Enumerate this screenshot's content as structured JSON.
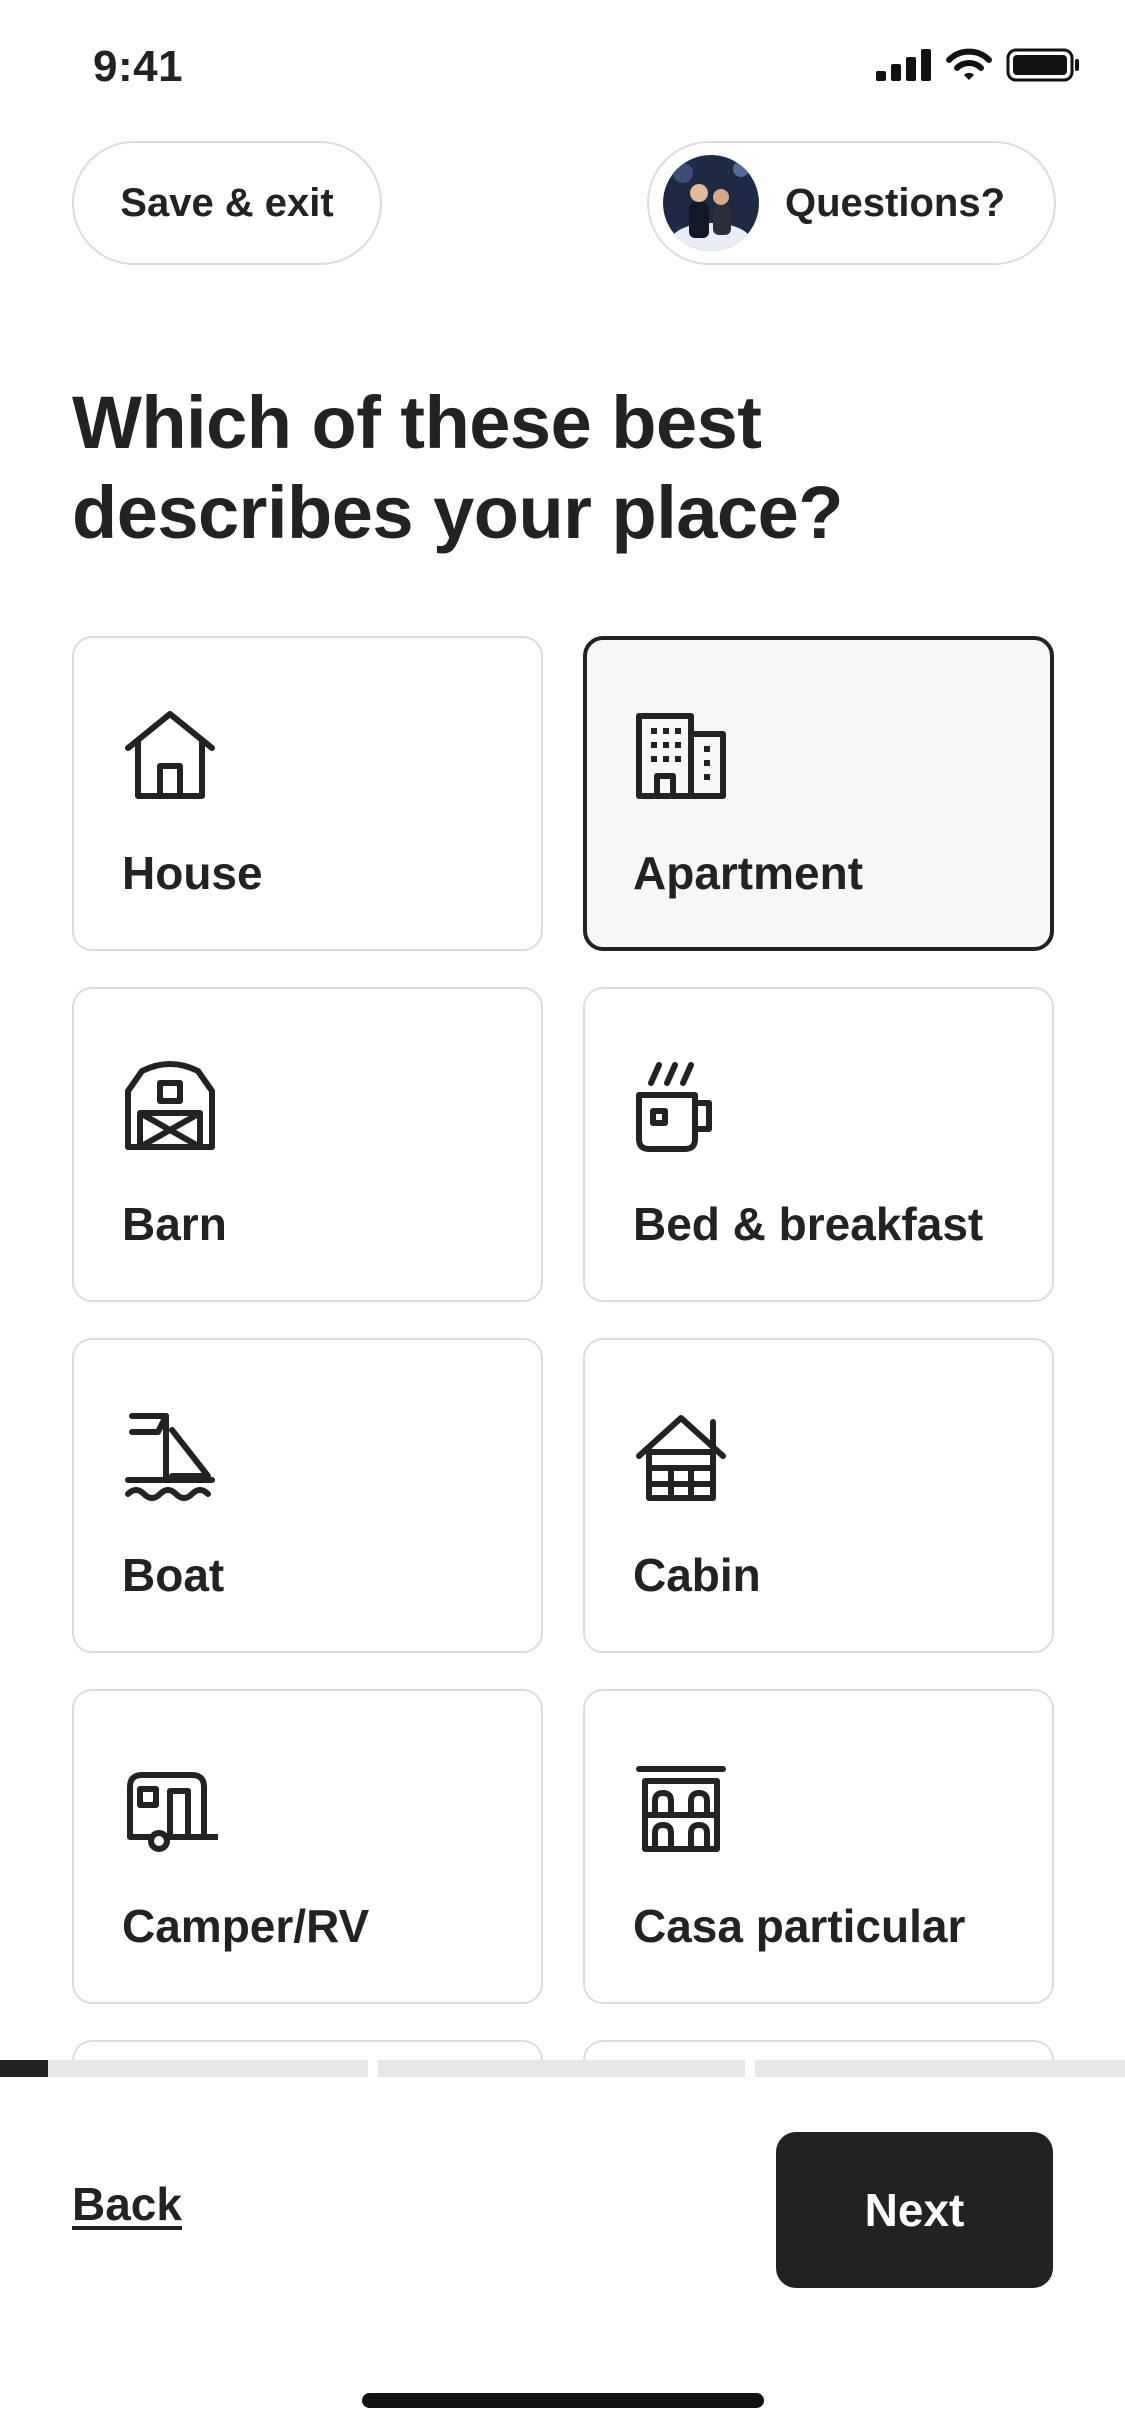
{
  "status_bar": {
    "time": "9:41",
    "icons": [
      "cellular-signal-icon",
      "wifi-icon",
      "battery-icon"
    ]
  },
  "header": {
    "save_exit_label": "Save & exit",
    "questions_label": "Questions?"
  },
  "title": "Which of these best describes your place?",
  "property_types": [
    {
      "label": "House",
      "icon": "house-icon",
      "selected": false
    },
    {
      "label": "Apartment",
      "icon": "apartment-building-icon",
      "selected": true
    },
    {
      "label": "Barn",
      "icon": "barn-icon",
      "selected": false
    },
    {
      "label": "Bed & breakfast",
      "icon": "coffee-mug-icon",
      "selected": false
    },
    {
      "label": "Boat",
      "icon": "sailboat-icon",
      "selected": false
    },
    {
      "label": "Cabin",
      "icon": "cabin-icon",
      "selected": false
    },
    {
      "label": "Camper/RV",
      "icon": "camper-icon",
      "selected": false
    },
    {
      "label": "Casa particular",
      "icon": "casa-particular-icon",
      "selected": false
    }
  ],
  "progress": {
    "steps": 3,
    "step1_fill": 0.13
  },
  "footer": {
    "back_label": "Back",
    "next_label": "Next"
  },
  "colors": {
    "text": "#222222",
    "border": "#dddddd",
    "selected_bg": "#f7f7f7",
    "button_bg": "#222222",
    "progress_track": "#e7e7e7"
  }
}
